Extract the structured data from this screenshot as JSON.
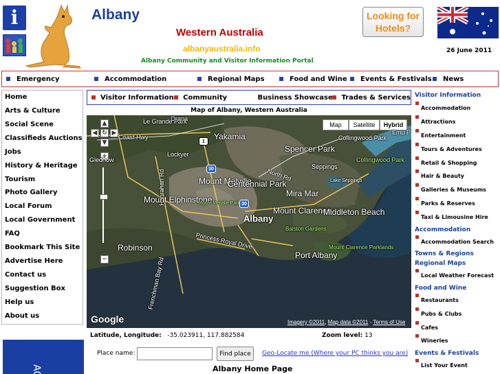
{
  "header": {
    "site_title": "Albany",
    "region_title": "Western Australia",
    "url": "albanyaustralia.info",
    "tagline": "Albany Community and Visitor Information Portal",
    "hotels_button": "Looking for Hotels?",
    "date": "26 June 2011",
    "info_icon_glyph": "i"
  },
  "top_nav": [
    {
      "label": "Emergency"
    },
    {
      "label": "Accommodation"
    },
    {
      "label": "Regional Maps"
    },
    {
      "label": "Food and Wine"
    },
    {
      "label": "Events & Festivals"
    },
    {
      "label": "News"
    }
  ],
  "left_nav": [
    "Home",
    "Arts & Culture",
    "Social Scene",
    "Classifieds Auctions",
    "Jobs",
    "History & Heritage",
    "Tourism",
    "Photo Gallery",
    "Local Forum",
    "Local Government",
    "FAQ",
    "Bookmark This Site",
    "Advertise Here",
    "Contact us",
    "Suggestion Box",
    "Help us",
    "About us"
  ],
  "sub_nav": [
    "Visitor Information",
    "Community",
    "Business Showcase",
    "Trades & Services"
  ],
  "map": {
    "title": "Map of Albany, Western Australia",
    "type_buttons": [
      "Map",
      "Satellite",
      "Hybrid"
    ],
    "active_type": "Hybrid",
    "labels": {
      "le_grande_park": "Le Grande Park",
      "orana": "Orana",
      "coast_hwy": "Coast Hwy",
      "yakamia": "Yakamia",
      "collingwood_park": "Collingwood Park",
      "emu_point": "Emu P",
      "lockyer": "Lockyer",
      "spencer_park": "Spencer Park",
      "collingwood_park_green": "Collingwood Park",
      "seppings": "Seppings",
      "gledhow": "Gledhow",
      "hanrahan_rd": "Hanrahan Rd",
      "mount_melville": "Mount Melville",
      "centennial_park": "Centennial Park",
      "north_rd": "North Rd",
      "mira_mar": "Mira Mar",
      "lake_seppings": "Lake Seppings",
      "mount_elphinstone": "Mount Elphinstone",
      "mount_melville_parklands": "Mount Melville Parklands",
      "mount_clarence": "Mount Clarence",
      "middleton_beach": "Middleton Beach",
      "albany": "Albany",
      "balston_gardens": "Balston Gardens",
      "princess_royal_drive": "Princess Royal Drive",
      "robinson": "Robinson",
      "port_albany": "Port Albany",
      "mount_clarence_parklands": "Mount Clarence Parklands",
      "frenchman_bay_rd": "Frenchman Bay Rd",
      "road_1": "1",
      "road_30a": "30",
      "road_30b": "30"
    },
    "imagery_attr": "Imagery ©2011",
    "data_attr": "Map data ©2011",
    "terms": "Terms of Use",
    "google_logo": "Google"
  },
  "location": {
    "latlon_label": "Latitude, Longitude:",
    "latlon_value": "-35.023911, 117.882584",
    "zoom_label": "Zoom level:",
    "zoom_value": "13"
  },
  "search": {
    "place_label": "Place name:",
    "place_value": "",
    "find_button": "Find place",
    "geo_link": "Geo-Locate me (Where your PC thinks you are)"
  },
  "page_heading": "Albany Home Page",
  "right_nav": {
    "visitor_info": {
      "heading": "Visitor Information",
      "items": [
        "Accommodation",
        "Attractions",
        "Entertainment",
        "Tours & Adventures",
        "Retail & Shopping",
        "Hair & Beauty",
        "Galleries & Museums",
        "Parks & Reserves",
        "Taxi & Limousine Hire"
      ]
    },
    "accommodation": {
      "heading": "Accommodation",
      "items": [
        "Accommodation Search"
      ]
    },
    "towns": {
      "heading": "Towns & Regions"
    },
    "regional_maps": {
      "heading": "Regional Maps",
      "items": [
        "Local Weather Forecast"
      ]
    },
    "food_wine": {
      "heading": "Food and Wine",
      "items": [
        "Restaurants",
        "Pubs & Clubs",
        "Cafes",
        "Wineries"
      ]
    },
    "events": {
      "heading": "Events & Festivals",
      "items": [
        "List Your Event"
      ]
    }
  },
  "banner_text": "AC",
  "colors": {
    "brand_blue": "#1b3f9a",
    "title_red": "#c00000",
    "url_yellow": "#f3b800",
    "tagline_green": "#168a22",
    "hotels_orange": "#f08a1c",
    "nav_border_red": "#c8363a",
    "bullet_blue": "#2a3fb5",
    "bullet_red": "#c0302a"
  }
}
